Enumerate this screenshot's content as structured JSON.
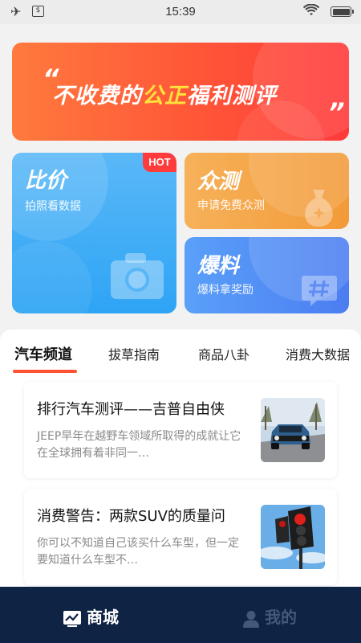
{
  "status_bar": {
    "time": "15:39"
  },
  "banner": {
    "quote_open": "“",
    "quote_close": "”",
    "slogan_before": "不收费的",
    "slogan_highlight": "公正",
    "slogan_after": "福利测评"
  },
  "cards": {
    "compare": {
      "title": "比价",
      "subtitle": "拍照看数据",
      "badge": "HOT",
      "icon": "camera-icon"
    },
    "crowd_test": {
      "title": "众测",
      "subtitle": "申请免费众测",
      "icon": "money-bag-icon"
    },
    "tip_off": {
      "title": "爆料",
      "subtitle": "爆料拿奖励",
      "icon": "hashtag-chat-icon"
    }
  },
  "tabs": [
    {
      "label": "汽车频道",
      "active": true
    },
    {
      "label": "拔草指南",
      "active": false
    },
    {
      "label": "商品八卦",
      "active": false
    },
    {
      "label": "消费大数据",
      "active": false
    }
  ],
  "articles": [
    {
      "title": "排行汽车测评——吉普自由侠",
      "description": "JEEP早年在越野车领域所取得的成就让它在全球拥有着非同一…",
      "thumbnail": "blue-jeep-photo"
    },
    {
      "title": "消费警告：两款SUV的质量问",
      "description": "你可以不知道自己该买什么车型，但一定要知道什么车型不…",
      "thumbnail": "traffic-light-photo"
    }
  ],
  "bottom_nav": {
    "shop": {
      "label": "商城",
      "icon": "chart-monitor-icon",
      "active": true
    },
    "mine": {
      "label": "我的",
      "icon": "person-icon",
      "active": false
    }
  },
  "colors": {
    "banner_gradient_start": "#ff7a3d",
    "banner_gradient_end": "#ff3a3a",
    "highlight": "#ffe23b",
    "compare_card": "#3aaaf6",
    "crowd_card": "#f4a548",
    "tip_card": "#5090f5",
    "tab_underline": "#ff5233",
    "bottom_bar": "#0f2345"
  }
}
